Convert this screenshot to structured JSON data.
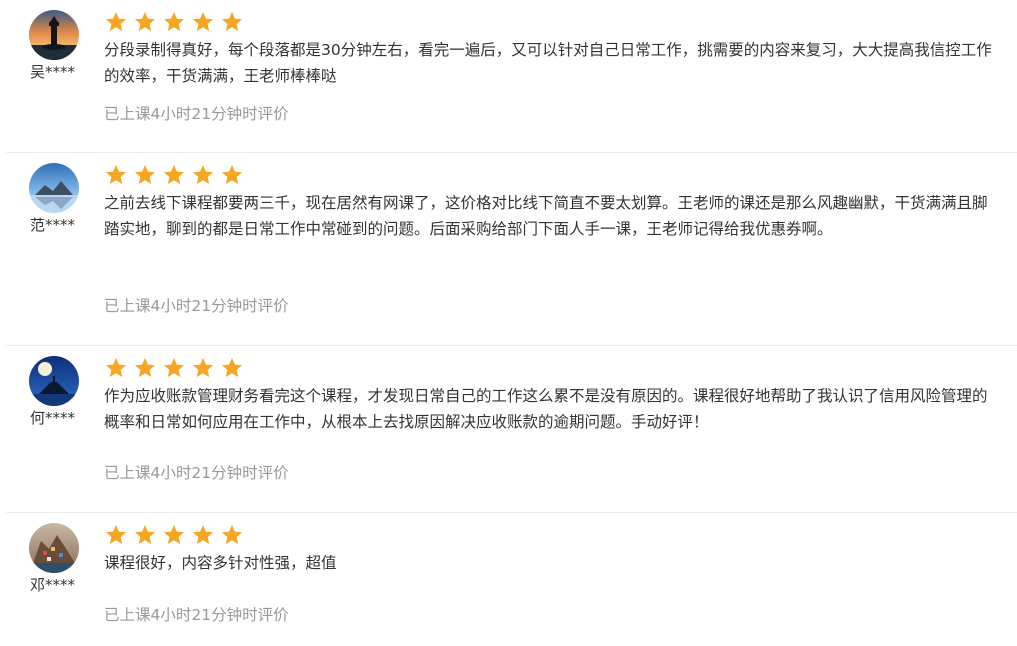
{
  "rating_max": 5,
  "star_color": "#F5A623",
  "star_icon": "star-icon",
  "reviews": [
    {
      "username": "吴****",
      "rating": 5,
      "comment": "分段录制得真好，每个段落都是30分钟左右，看完一遍后，又可以针对自己日常工作，挑需要的内容来复习，大大提高我信控工作的效率，干货满满，王老师棒棒哒",
      "meta": "已上课4小时21分钟时评价"
    },
    {
      "username": "范****",
      "rating": 5,
      "comment": "之前去线下课程都要两三千，现在居然有网课了，这价格对比线下简直不要太划算。王老师的课还是那么风趣幽默，干货满满且脚踏实地，聊到的都是日常工作中常碰到的问题。后面采购给部门下面人手一课，王老师记得给我优惠券啊。",
      "meta": "已上课4小时21分钟时评价"
    },
    {
      "username": "何****",
      "rating": 5,
      "comment": "作为应收账款管理财务看完这个课程，才发现日常自己的工作这么累不是没有原因的。课程很好地帮助了我认识了信用风险管理的概率和日常如何应用在工作中，从根本上去找原因解决应收账款的逾期问题。手动好评！",
      "meta": "已上课4小时21分钟时评价"
    },
    {
      "username": "邓****",
      "rating": 5,
      "comment": "课程很好，内容多针对性强，超值",
      "meta": "已上课4小时21分钟时评价"
    }
  ]
}
